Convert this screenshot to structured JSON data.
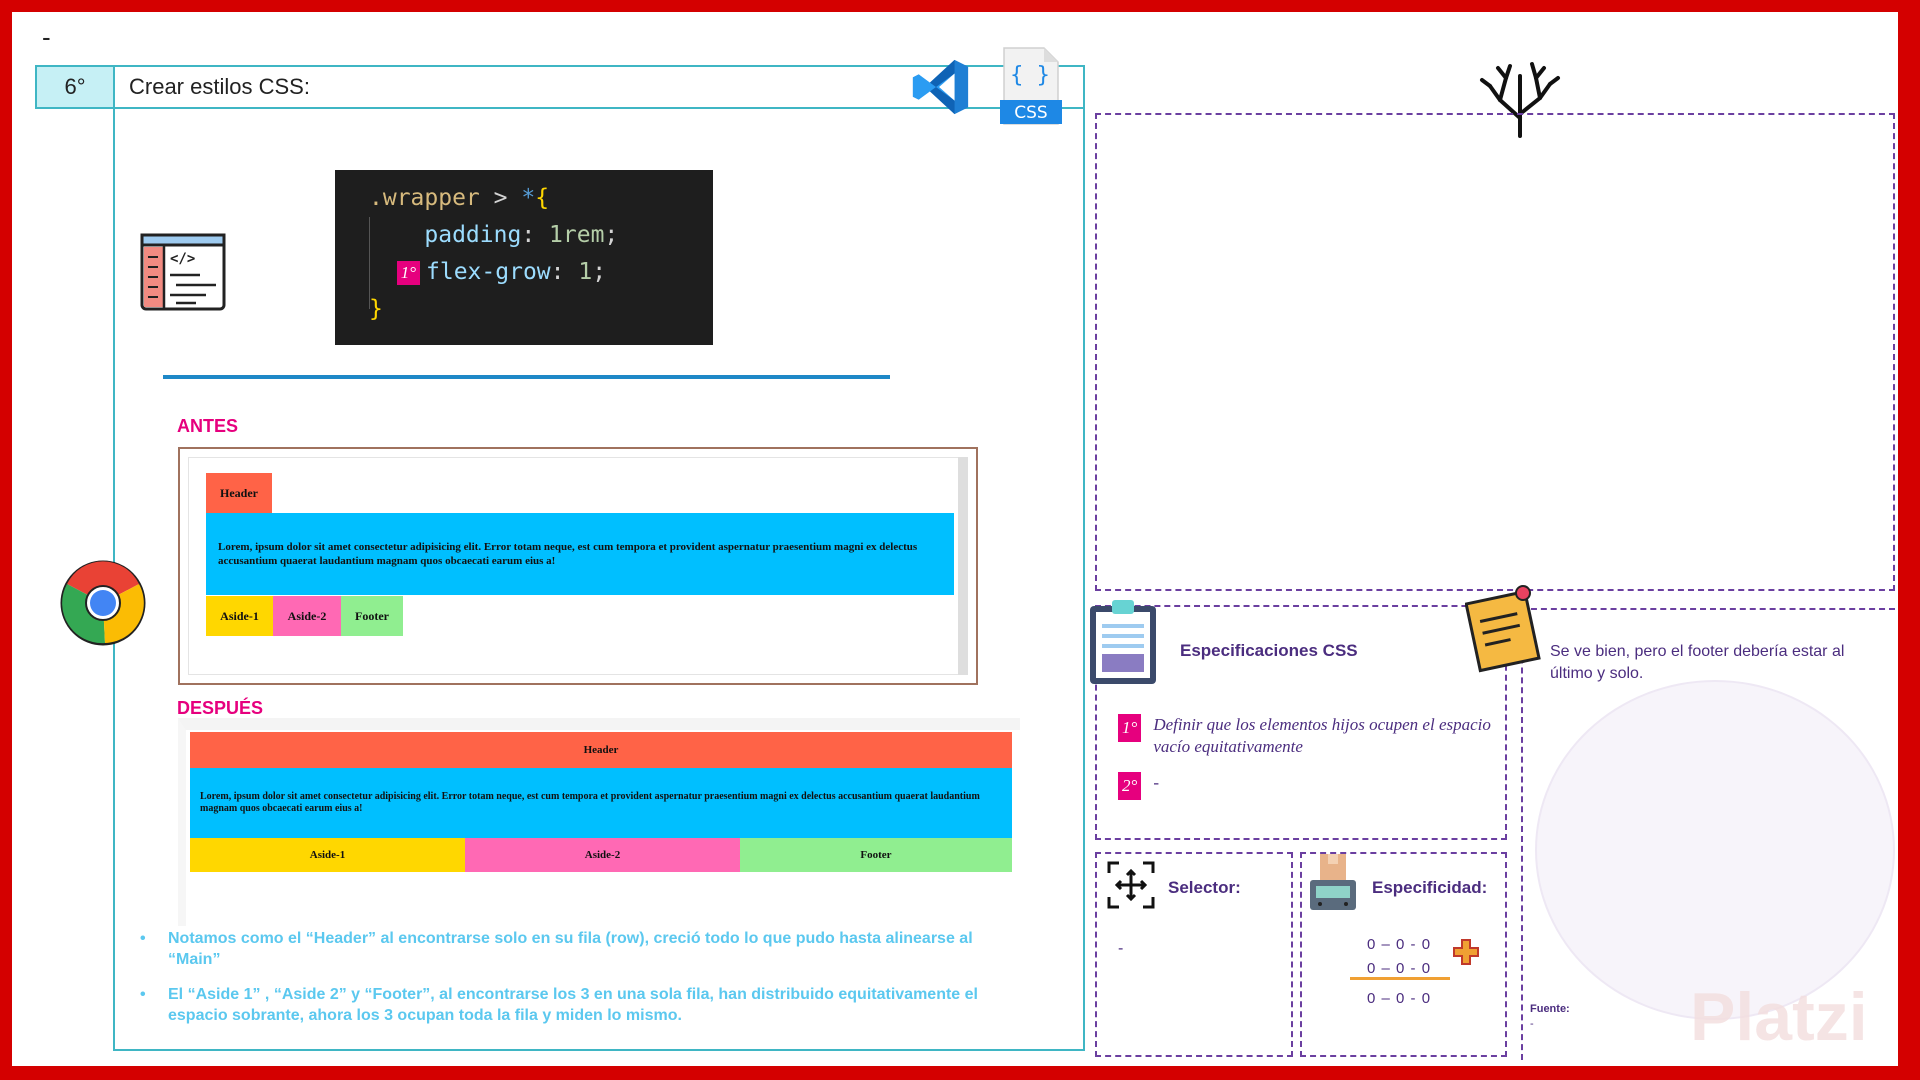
{
  "top_dash": "-",
  "step": {
    "number": "6°",
    "title": "Crear estilos CSS:"
  },
  "icons": {
    "vscode": "vscode-icon",
    "css_file": "css-file-icon",
    "css_file_label": "CSS",
    "code_window": "code-window-icon",
    "chrome": "chrome-icon",
    "tree": "tree-icon",
    "clipboard": "clipboard-icon",
    "sticky_note": "sticky-note-icon",
    "selector": "selector-icon",
    "scale": "scale-icon",
    "plus": "plus-icon"
  },
  "code": {
    "selector": ".wrapper",
    "combinator": " > ",
    "star": "*",
    "open_brace": "{",
    "line2_prop": "padding",
    "line2_val": "1rem",
    "line3_badge": "1°",
    "line3_prop": "flex-grow",
    "line3_val": "1",
    "close_brace": "}"
  },
  "antes": {
    "label": "ANTES",
    "header": "Header",
    "main": "Lorem, ipsum dolor sit amet consectetur adipisicing elit. Error totam neque, est cum tempora et provident aspernatur praesentium magni ex delectus accusantium quaerat laudantium magnam quos obcaecati earum eius a!",
    "aside1": "Aside-1",
    "aside2": "Aside-2",
    "footer": "Footer"
  },
  "despues": {
    "label": "DESPUÉS",
    "header": "Header",
    "main": "Lorem, ipsum dolor sit amet consectetur adipisicing elit. Error totam neque, est cum tempora et provident aspernatur praesentium magni ex delectus accusantium quaerat laudantium magnam quos obcaecati earum eius a!",
    "aside1": "Aside-1",
    "aside2": "Aside-2",
    "footer": "Footer"
  },
  "notes": [
    "Notamos como el “Header” al encontrarse solo en su fila (row), creció todo lo que pudo hasta alinearse al “Main”",
    "El “Aside 1” , “Aside 2” y “Footer”, al encontrarse los 3 en una sola fila, han distribuido equitativamente el espacio sobrante, ahora los 3 ocupan toda la fila y miden lo mismo."
  ],
  "specs": {
    "title": "Especificaciones CSS",
    "items": [
      {
        "badge": "1°",
        "text": "Definir que los elementos hijos ocupen el espacio vacío equitativamente"
      },
      {
        "badge": "2°",
        "text": "-"
      }
    ]
  },
  "note": {
    "text": "Se ve bien, pero el footer debería estar al último y solo.",
    "source_label": "Fuente:",
    "source_value": "-",
    "watermark": "Platzi"
  },
  "selector": {
    "title": "Selector:",
    "value": "-"
  },
  "especificidad": {
    "title": "Especificidad:",
    "row1": "0 – 0 - 0",
    "row2": "0 – 0 - 0",
    "row3": "0 – 0 - 0"
  },
  "colors": {
    "frame": "#d40000",
    "teal": "#3fb6c4",
    "purple": "#6b3fa0",
    "pink": "#e6007e",
    "header_demo": "#ff6347",
    "main_demo": "#00bfff",
    "aside1_demo": "#ffd700",
    "aside2_demo": "#ff69b4",
    "footer_demo": "#90ee90"
  }
}
